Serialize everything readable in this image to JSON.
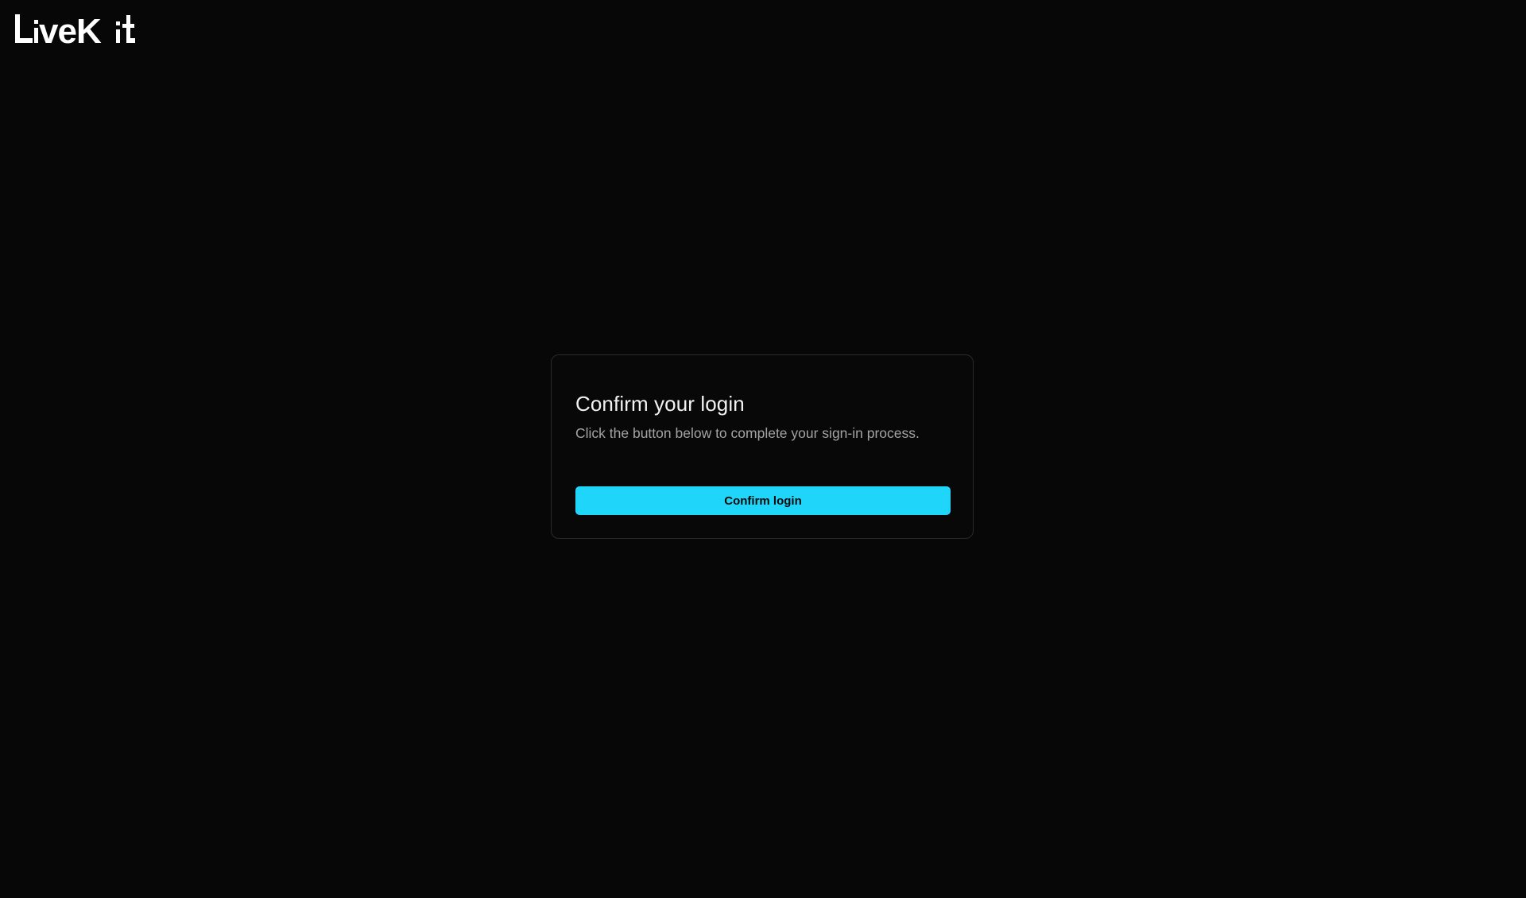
{
  "brand": {
    "logo_text": "LiveKit",
    "text_color": "#ffffff"
  },
  "login_card": {
    "title": "Confirm your login",
    "description": "Click the button below to complete your sign-in process.",
    "confirm_label": "Confirm login",
    "accent_color": "#1fd5f9"
  },
  "colors": {
    "background": "#070707",
    "card_border": "#2a2a2a",
    "title_text": "#f2f2f2",
    "description_text": "#a3a3a3"
  }
}
